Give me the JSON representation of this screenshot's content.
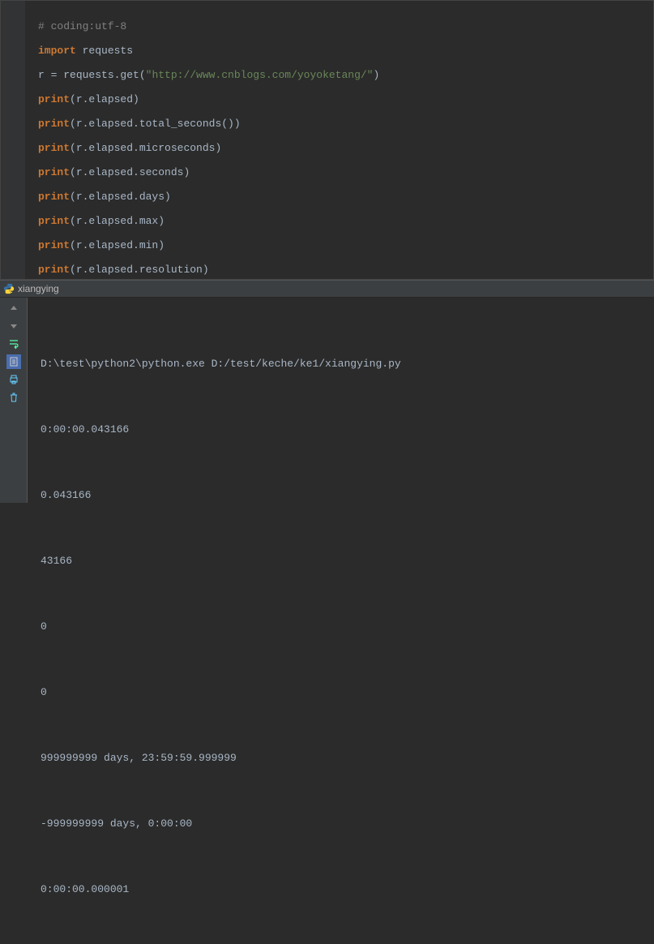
{
  "code": {
    "comment": "# coding:utf-8",
    "import_kw": "import",
    "import_mod": " requests",
    "assign_lhs": "r ",
    "assign_eq": "=",
    "assign_rhs1": " requests.get(",
    "assign_str": "\"http://www.cnblogs.com/yoyoketang/\"",
    "assign_rhs2": ")",
    "print_kw": "print",
    "p1": "(r.elapsed)",
    "p2a": "(r.elapsed.total_seconds",
    "p2b": "())",
    "p3": "(r.elapsed.microseconds)",
    "p4": "(r.elapsed.seconds)",
    "p5": "(r.elapsed.days)",
    "p6": "(r.elapsed.max)",
    "p7": "(r.elapsed.min)",
    "p8": "(r.elapsed.resolution)"
  },
  "tab": {
    "name": "xiangying"
  },
  "console": {
    "line1": "D:\\test\\python2\\python.exe D:/test/keche/ke1/xiangying.py",
    "line2": "0:00:00.043166",
    "line3": "0.043166",
    "line4": "43166",
    "line5": "0",
    "line6": "0",
    "line7": "999999999 days, 23:59:59.999999",
    "line8": "-999999999 days, 0:00:00",
    "line9": "0:00:00.000001"
  }
}
